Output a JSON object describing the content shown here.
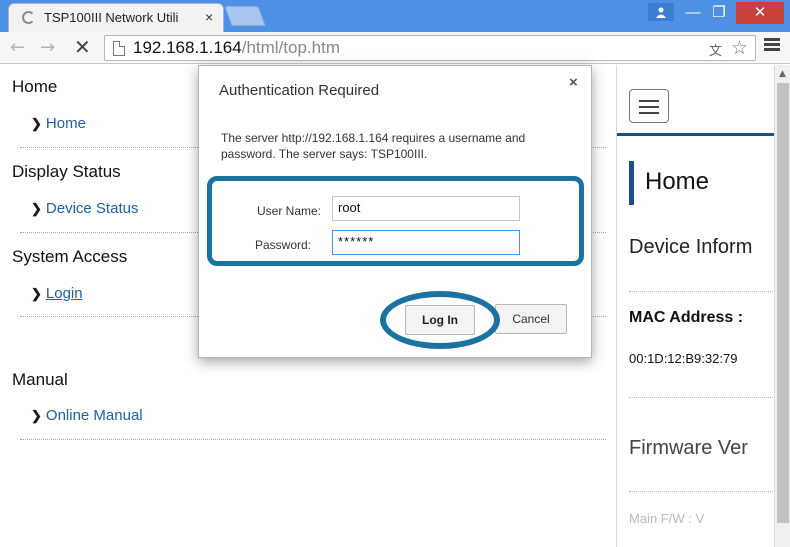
{
  "browser": {
    "tab_title": "TSP100III Network Utili",
    "tab_close": "×",
    "url_host": "192.168.1.164",
    "url_path": "/html/top.htm",
    "win_min": "—",
    "win_max": "❐",
    "win_close": "✕"
  },
  "nav": {
    "sections": [
      {
        "title": "Home",
        "link": "Home"
      },
      {
        "title": "Display Status",
        "link": "Device Status"
      },
      {
        "title": "System Access",
        "link": "Login"
      },
      {
        "title": "Manual",
        "link": "Online Manual"
      }
    ]
  },
  "right_panel": {
    "heading": "Home",
    "subheading": "Device Inform",
    "mac_label": "MAC Address :",
    "mac_value": "00:1D:12:B9:32:79",
    "firmware_heading": "Firmware Ver",
    "faded_label": "Main F/W : V"
  },
  "dialog": {
    "title": "Authentication Required",
    "close": "×",
    "message": "The server http://192.168.1.164 requires a username and password. The server says: TSP100III.",
    "username_label": "User Name:",
    "username_value": "root",
    "password_label": "Password:",
    "password_value": "******",
    "login_label": "Log In",
    "cancel_label": "Cancel"
  },
  "colors": {
    "titlebar": "#4d90e4",
    "accent": "#1b72a0",
    "link": "#1d5fa8",
    "heading_bar": "#1a4f8c"
  }
}
